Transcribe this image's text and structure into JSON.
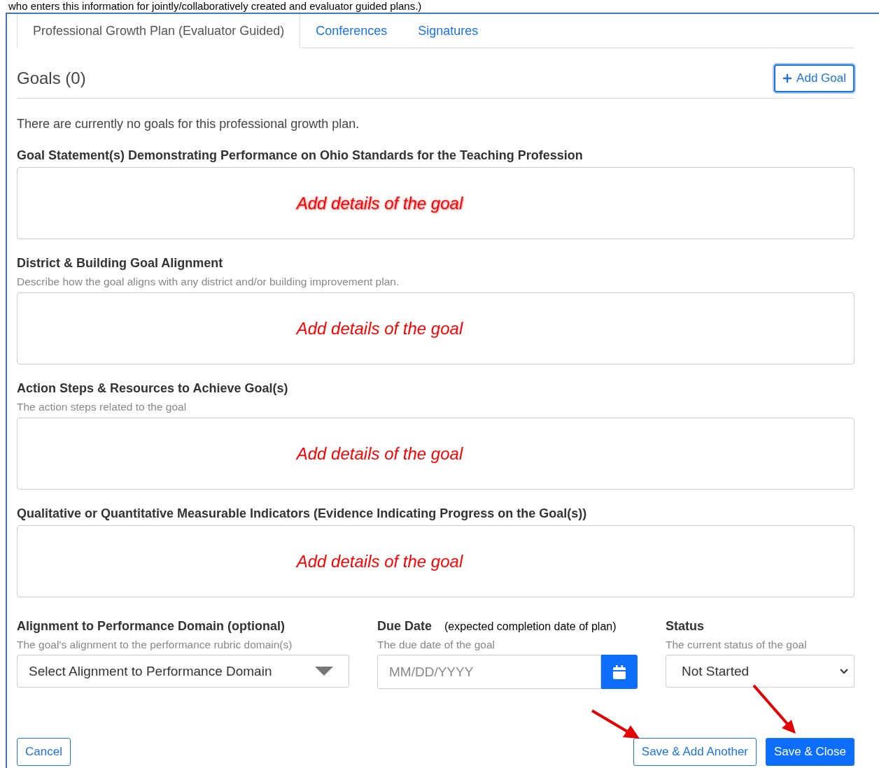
{
  "caption": "who enters this information for jointly/collaboratively created and evaluator guided plans.)",
  "tabs": [
    {
      "label": "Professional Growth Plan (Evaluator Guided)",
      "selected": true
    },
    {
      "label": "Conferences",
      "selected": false
    },
    {
      "label": "Signatures",
      "selected": false
    }
  ],
  "goals_header": {
    "title": "Goals (0)",
    "add_button": "Add Goal"
  },
  "empty_message": "There are currently no goals for this professional growth plan.",
  "sections": [
    {
      "label": "Goal Statement(s) Demonstrating Performance on Ohio Standards for the Teaching Profession",
      "annotation": "Add details of the goal",
      "kind": "glow"
    },
    {
      "label": "District & Building Goal Alignment",
      "help": "Describe how the goal aligns with any district and/or building improvement plan.",
      "annotation": "Add details of the goal",
      "kind": "plain"
    },
    {
      "label": "Action Steps & Resources to Achieve Goal(s)",
      "help": "The action steps related to the goal",
      "annotation": "Add details of the goal",
      "kind": "plain"
    },
    {
      "label": "Qualitative or Quantitative Measurable Indicators (Evidence Indicating Progress on the Goal(s))",
      "annotation": "Add details of the goal",
      "kind": "plain"
    }
  ],
  "bottom_fields": [
    {
      "kind": "select",
      "label": "Alignment to Performance Domain (optional)",
      "help": "The goal’s alignment to the performance rubric domain(s)",
      "value": "Select Alignment to Performance Domain"
    },
    {
      "kind": "date",
      "label": "Due Date",
      "note": "(expected completion date of plan)",
      "help": "The due date of the goal",
      "placeholder": "MM/DD/YYYY"
    },
    {
      "kind": "dropdown",
      "label": "Status",
      "help": "The current status of the goal",
      "value": "Not Started"
    }
  ],
  "buttons": [
    {
      "label": "Cancel",
      "kind": "outline"
    },
    {
      "label": "Save & Add Another",
      "kind": "outline"
    },
    {
      "label": "Save & Close",
      "kind": "primary"
    }
  ]
}
